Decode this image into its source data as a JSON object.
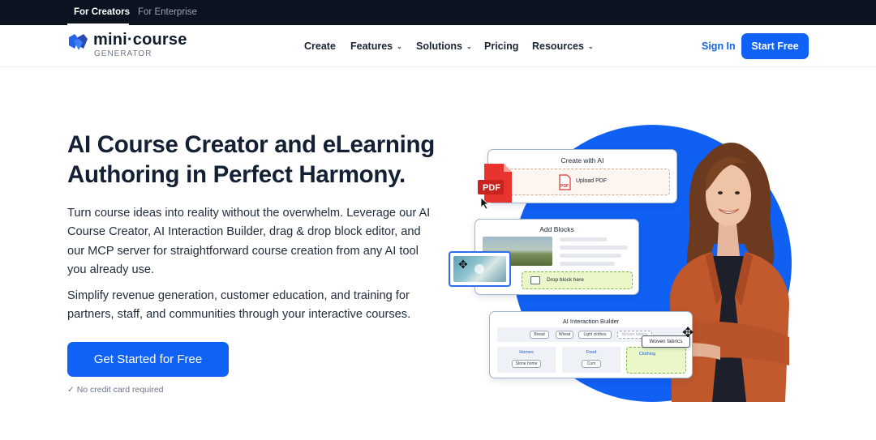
{
  "topbar": {
    "tabs": [
      {
        "label": "For Creators",
        "active": true
      },
      {
        "label": "For Enterprise",
        "active": false
      }
    ]
  },
  "nav": {
    "logo_text": "mini·course",
    "logo_sub": "GENERATOR",
    "items": [
      {
        "label": "Create",
        "dropdown": false
      },
      {
        "label": "Features",
        "dropdown": true
      },
      {
        "label": "Solutions",
        "dropdown": true
      },
      {
        "label": "Pricing",
        "dropdown": false
      },
      {
        "label": "Resources",
        "dropdown": true
      }
    ],
    "sign_in": "Sign In",
    "start_free": "Start Free"
  },
  "hero": {
    "title_line1": "AI Course Creator and eLearning",
    "title_line2": "Authoring in Perfect Harmony.",
    "paragraph1": "Turn course ideas into reality without the overwhelm. Leverage our AI Course Creator, AI Interaction Builder, drag & drop block editor, and our MCP server for straightforward course creation from any AI tool you already use.",
    "paragraph2": "Simplify revenue generation, customer education, and training for partners, staff, and communities through your interactive courses.",
    "cta": "Get Started for Free",
    "note": "✓ No credit card required"
  },
  "illustration": {
    "card1": {
      "title": "Create with AI",
      "upload_label": "Upload PDF",
      "pdf_badge": "PDF",
      "pdf_icon_text": "PDF"
    },
    "card2": {
      "title": "Add Blocks",
      "drop_label": "Drop block here"
    },
    "card3": {
      "title": "AI Interaction Builder",
      "chips": [
        "Bread",
        "Wheat",
        "Light clothes",
        "Woven fabrics"
      ],
      "columns": [
        {
          "header": "Homes",
          "item": "Stone home"
        },
        {
          "header": "Food",
          "item": "Corn"
        },
        {
          "header": "Clothing",
          "item": ""
        }
      ],
      "drag_chip": "Woven fabrics"
    }
  },
  "colors": {
    "brand_blue": "#0f62f5",
    "topbar_bg": "#0b1220",
    "circle_blue": "#1060f3",
    "pdf_red": "#e0302a",
    "drop_green": "#eaf8c9"
  }
}
